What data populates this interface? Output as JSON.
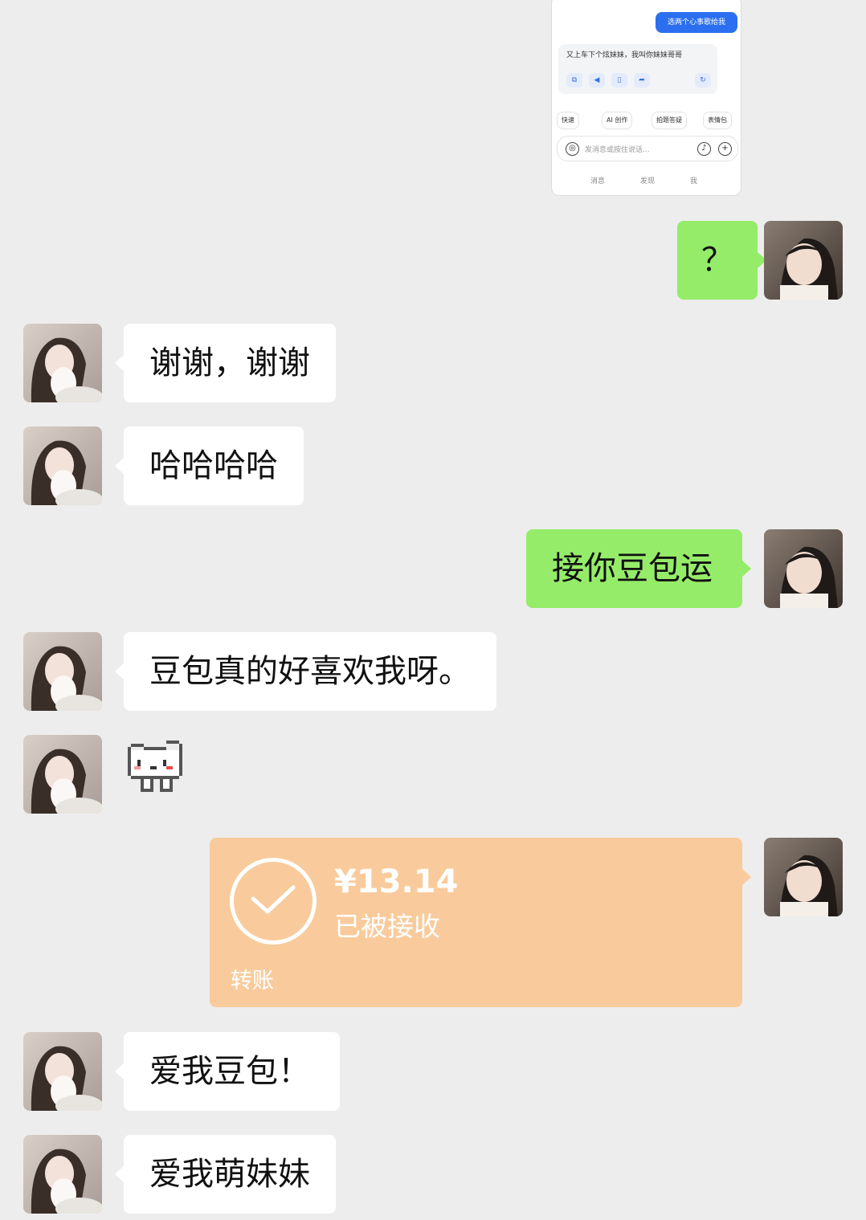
{
  "screenshot_thumb": {
    "send_bubble": "选两个心事歌给我",
    "reply_text": "又上车下个炫妹妹，我叫你妹妹哥哥",
    "chips": [
      "快速",
      "AI 创作",
      "拍题答疑",
      "表情包"
    ],
    "input_placeholder": "发消息或按住说话...",
    "nav": [
      "消息",
      "发现",
      "我"
    ]
  },
  "messages": [
    {
      "side": "out",
      "text": "？"
    },
    {
      "side": "in",
      "text": "谢谢，谢谢"
    },
    {
      "side": "in",
      "text": "哈哈哈哈"
    },
    {
      "side": "out",
      "text": "接你豆包运"
    },
    {
      "side": "in",
      "text": "豆包真的好喜欢我呀。"
    },
    {
      "side": "in",
      "sticker": "pixel-cat-sticker"
    },
    {
      "side": "out",
      "transfer": true
    },
    {
      "side": "in",
      "text": "爱我豆包！"
    },
    {
      "side": "in",
      "text": "爱我萌妹妹"
    }
  ],
  "transfer": {
    "amount": "¥13.14",
    "status": "已被接收",
    "label": "转账"
  },
  "colors": {
    "background": "#ededed",
    "bubble_out": "#95ec69",
    "bubble_in": "#ffffff",
    "transfer": "#f9cb9c"
  }
}
